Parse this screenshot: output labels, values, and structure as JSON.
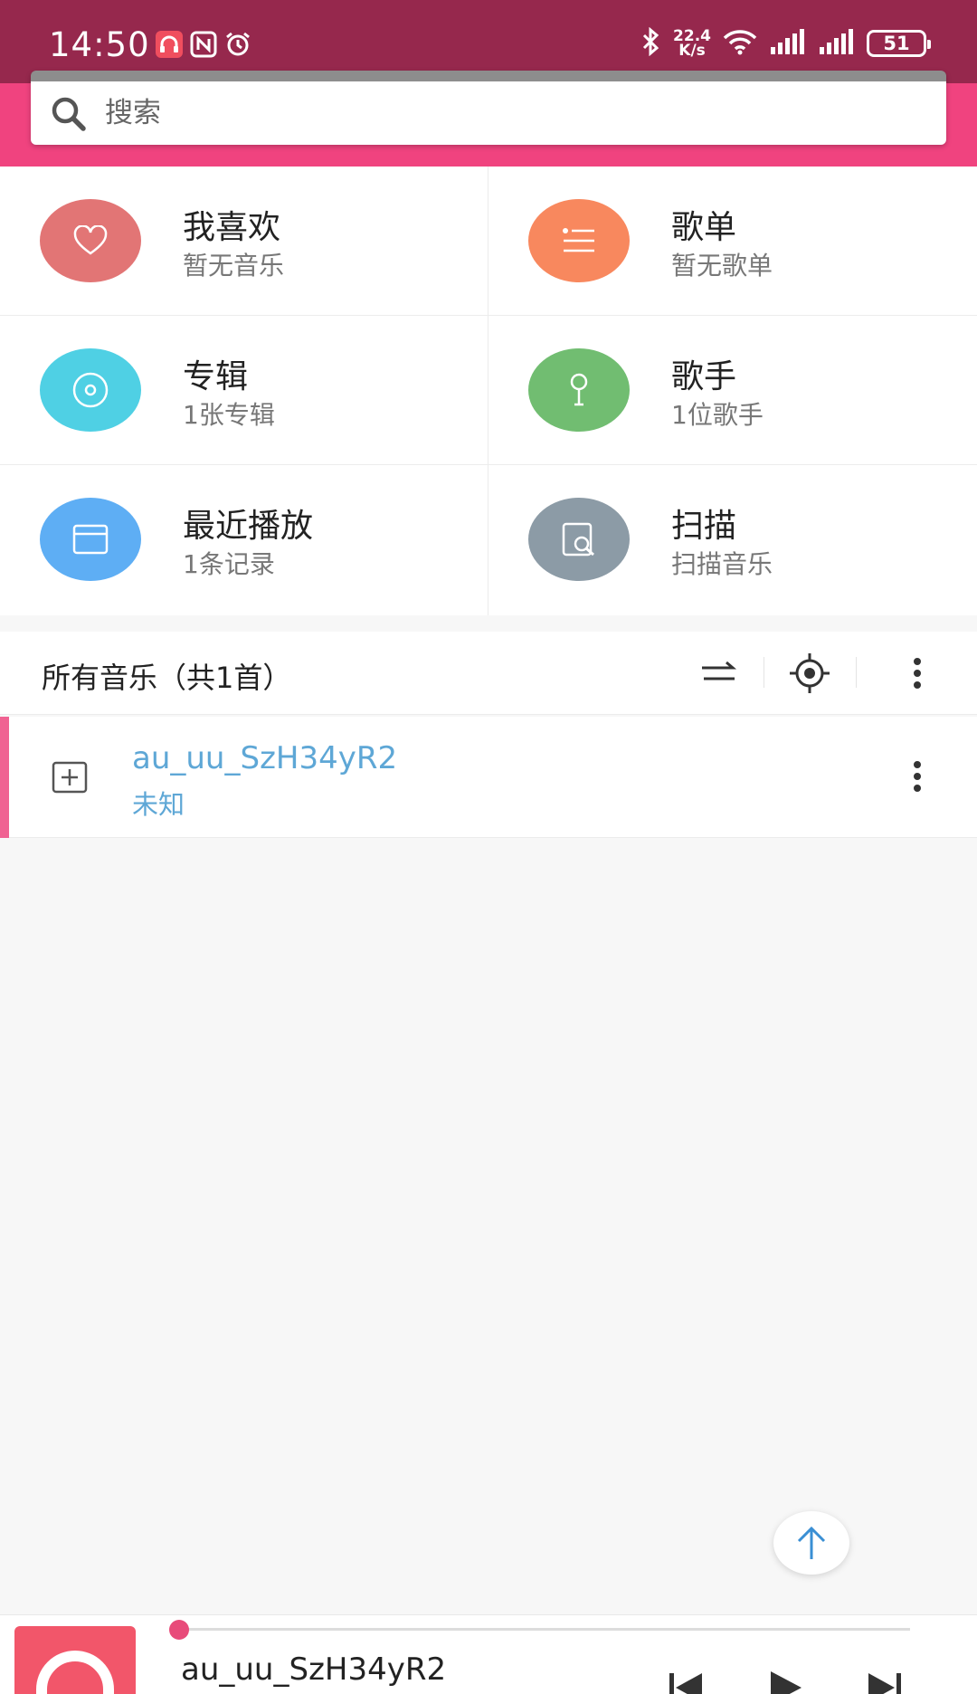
{
  "status_bar": {
    "time": "14:50",
    "net_speed_value": "22.4",
    "net_speed_unit": "K/s",
    "battery": "51"
  },
  "search": {
    "placeholder": "搜索"
  },
  "categories": [
    {
      "title": "我喜欢",
      "subtitle": "暂无音乐",
      "icon": "heart-icon",
      "color": "#e27575"
    },
    {
      "title": "歌单",
      "subtitle": "暂无歌单",
      "icon": "list-icon",
      "color": "#f8885e"
    },
    {
      "title": "专辑",
      "subtitle": "1张专辑",
      "icon": "disc-icon",
      "color": "#4fd0e4"
    },
    {
      "title": "歌手",
      "subtitle": "1位歌手",
      "icon": "microphone-icon",
      "color": "#71bd71"
    },
    {
      "title": "最近播放",
      "subtitle": "1条记录",
      "icon": "window-icon",
      "color": "#5eaef4"
    },
    {
      "title": "扫描",
      "subtitle": "扫描音乐",
      "icon": "scan-icon",
      "color": "#8c9ba6"
    }
  ],
  "all_music": {
    "title": "所有音乐（共1首）"
  },
  "songs": [
    {
      "title": "au_uu_SzH34yR2",
      "artist": "未知"
    }
  ],
  "player": {
    "title": "au_uu_SzH34yR2",
    "progress": 0.0
  },
  "colors": {
    "status_bar": "#96284d",
    "header": "#f0437f",
    "accent": "#e84b7a",
    "song_text": "#5ea7d6"
  }
}
